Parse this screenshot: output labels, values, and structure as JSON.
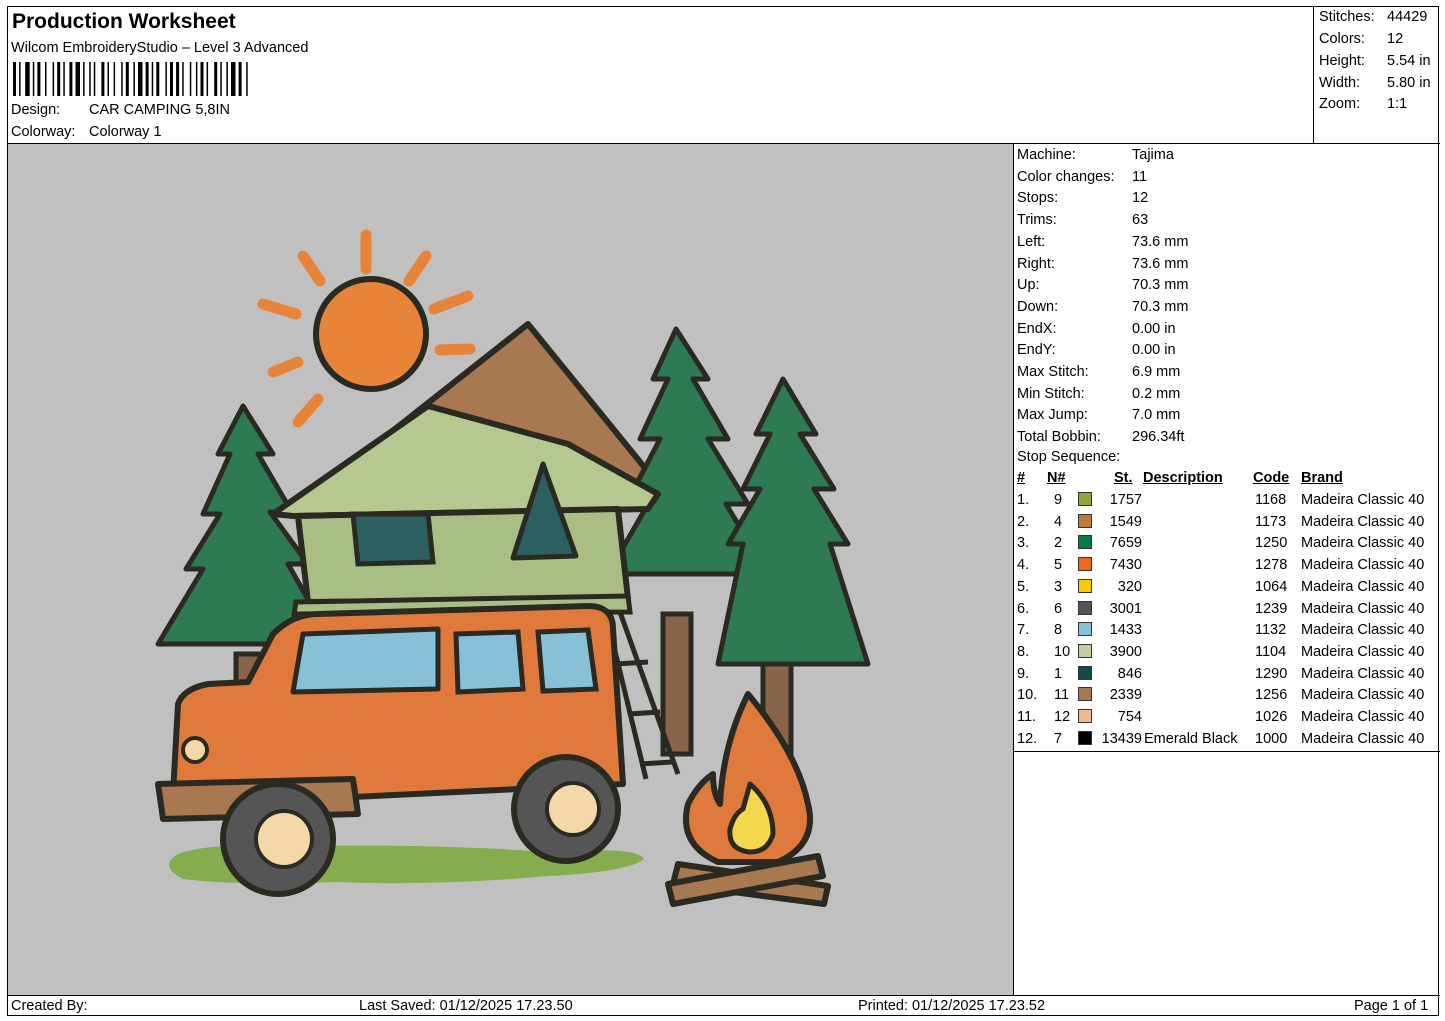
{
  "header": {
    "title": "Production Worksheet",
    "software": "Wilcom EmbroideryStudio – Level 3 Advanced",
    "design_label": "Design:",
    "design_value": "CAR CAMPING 5,8IN",
    "colorway_label": "Colorway:",
    "colorway_value": "Colorway 1"
  },
  "stats": [
    {
      "label": "Stitches:",
      "value": "44429"
    },
    {
      "label": "Colors:",
      "value": "12"
    },
    {
      "label": "Height:",
      "value": "5.54 in"
    },
    {
      "label": "Width:",
      "value": "5.80 in"
    },
    {
      "label": "Zoom:",
      "value": "1:1"
    }
  ],
  "machine_info": [
    {
      "label": "Machine:",
      "value": "Tajima"
    },
    {
      "label": "Color changes:",
      "value": "11"
    },
    {
      "label": "Stops:",
      "value": "12"
    },
    {
      "label": "Trims:",
      "value": "63"
    },
    {
      "label": "Left:",
      "value": "73.6 mm"
    },
    {
      "label": "Right:",
      "value": "73.6 mm"
    },
    {
      "label": "Up:",
      "value": "70.3 mm"
    },
    {
      "label": "Down:",
      "value": "70.3 mm"
    },
    {
      "label": "EndX:",
      "value": "0.00 in"
    },
    {
      "label": "EndY:",
      "value": "0.00 in"
    },
    {
      "label": "Max Stitch:",
      "value": "6.9 mm"
    },
    {
      "label": "Min Stitch:",
      "value": "0.2 mm"
    },
    {
      "label": "Max Jump:",
      "value": "7.0 mm"
    },
    {
      "label": "Total Bobbin:",
      "value": "296.34ft"
    }
  ],
  "stop_sequence": {
    "title": "Stop Sequence:",
    "headers": {
      "index": "#",
      "needle": "N#",
      "stitches": "St.",
      "description": "Description",
      "code": "Code",
      "brand": "Brand"
    },
    "rows": [
      {
        "index": "1.",
        "needle": "9",
        "color": "#8ea838",
        "stitches": "1757",
        "description": "",
        "code": "1168",
        "brand": "Madeira Classic 40"
      },
      {
        "index": "2.",
        "needle": "4",
        "color": "#c07a3c",
        "stitches": "1549",
        "description": "",
        "code": "1173",
        "brand": "Madeira Classic 40"
      },
      {
        "index": "3.",
        "needle": "2",
        "color": "#0b7a4a",
        "stitches": "7659",
        "description": "",
        "code": "1250",
        "brand": "Madeira Classic 40"
      },
      {
        "index": "4.",
        "needle": "5",
        "color": "#f06a1a",
        "stitches": "7430",
        "description": "",
        "code": "1278",
        "brand": "Madeira Classic 40"
      },
      {
        "index": "5.",
        "needle": "3",
        "color": "#f8c800",
        "stitches": "320",
        "description": "",
        "code": "1064",
        "brand": "Madeira Classic 40"
      },
      {
        "index": "6.",
        "needle": "6",
        "color": "#555555",
        "stitches": "3001",
        "description": "",
        "code": "1239",
        "brand": "Madeira Classic 40"
      },
      {
        "index": "7.",
        "needle": "8",
        "color": "#88c0d8",
        "stitches": "1433",
        "description": "",
        "code": "1132",
        "brand": "Madeira Classic 40"
      },
      {
        "index": "8.",
        "needle": "10",
        "color": "#c0d0a0",
        "stitches": "3900",
        "description": "",
        "code": "1104",
        "brand": "Madeira Classic 40"
      },
      {
        "index": "9.",
        "needle": "1",
        "color": "#0c4c44",
        "stitches": "846",
        "description": "",
        "code": "1290",
        "brand": "Madeira Classic 40"
      },
      {
        "index": "10.",
        "needle": "11",
        "color": "#a87850",
        "stitches": "2339",
        "description": "",
        "code": "1256",
        "brand": "Madeira Classic 40"
      },
      {
        "index": "11.",
        "needle": "12",
        "color": "#f4b890",
        "stitches": "754",
        "description": "",
        "code": "1026",
        "brand": "Madeira Classic 40"
      },
      {
        "index": "12.",
        "needle": "7",
        "color": "#000000",
        "stitches": "13439",
        "description": "Emerald Black",
        "code": "1000",
        "brand": "Madeira Classic 40"
      }
    ]
  },
  "footer": {
    "created_by": "Created By:",
    "last_saved": "Last Saved: 01/12/2025 17.23.50",
    "printed": "Printed: 01/12/2025 17.23.52",
    "page": "Page 1 of 1"
  }
}
